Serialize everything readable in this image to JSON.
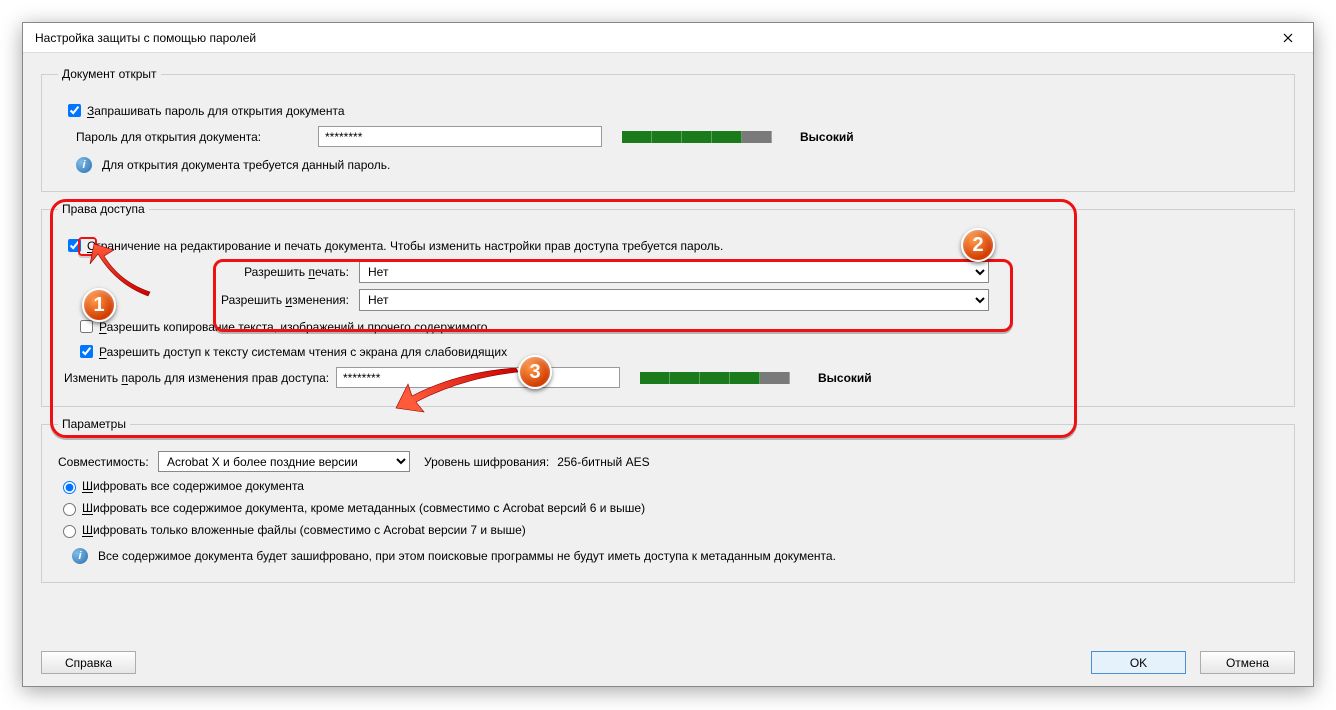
{
  "dialog": {
    "title": "Настройка защиты с помощью паролей"
  },
  "docOpen": {
    "legend": "Документ открыт",
    "requirePwdLabel": "Запрашивать пароль для открытия документа",
    "pwdLabel": "Пароль для открытия документа:",
    "pwdValue": "********",
    "strengthLabel": "Высокий",
    "infoText": "Для открытия документа требуется данный пароль."
  },
  "perm": {
    "legend": "Права доступа",
    "restrictLabel": "Ограничение на редактирование и печать документа. Чтобы изменить настройки прав доступа требуется пароль.",
    "allowPrintLabel": "Разрешить печать:",
    "allowPrintValue": "Нет",
    "allowChangesLabel": "Разрешить изменения:",
    "allowChangesValue": "Нет",
    "allowCopyLabel": "Разрешить копирование текста, изображений и прочего содержимого",
    "allowScreenReaderLabel": "Разрешить доступ к тексту системам чтения с экрана для слабовидящих",
    "changePwdLabel": "Изменить пароль для изменения прав доступа:",
    "changePwdValue": "********",
    "strengthLabel": "Высокий"
  },
  "params": {
    "legend": "Параметры",
    "compatLabel": "Совместимость:",
    "compatValue": "Acrobat X и более поздние версии",
    "encLevelLabel": "Уровень шифрования:",
    "encLevelValue": "256-битный AES",
    "radioAllLabel": "Шифровать все содержимое документа",
    "radioExceptMetaLabel": "Шифровать все содержимое документа, кроме метаданных (совместимо с Acrobat версий 6 и выше)",
    "radioAttachOnlyLabel": "Шифровать только вложенные файлы (совместимо с Acrobat версии 7 и выше)",
    "infoText": "Все содержимое документа будет зашифровано, при этом поисковые программы не будут иметь доступа к метаданным документа."
  },
  "footer": {
    "help": "Справка",
    "ok": "OK",
    "cancel": "Отмена"
  },
  "annotations": {
    "b1": "1",
    "b2": "2",
    "b3": "3"
  }
}
